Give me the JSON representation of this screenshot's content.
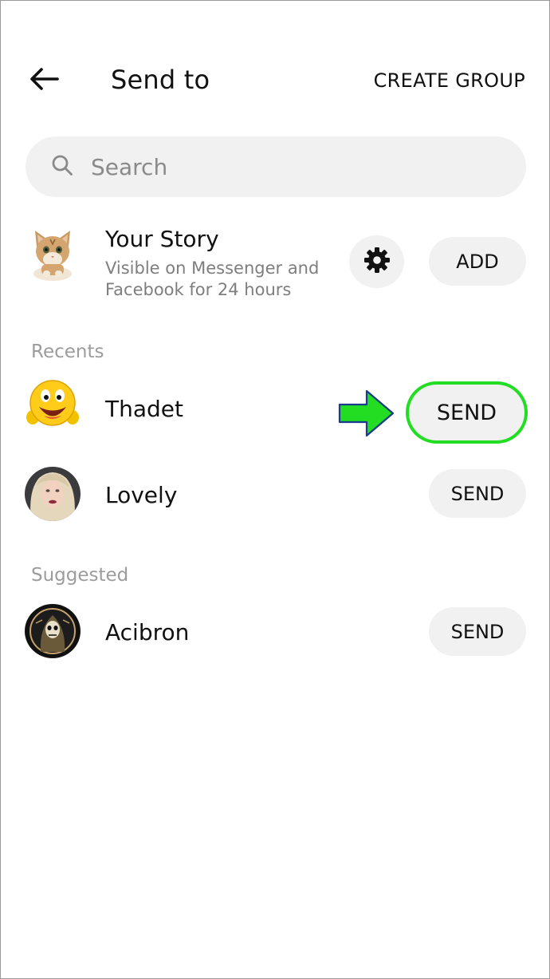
{
  "header": {
    "title": "Send to",
    "create_group": "CREATE GROUP"
  },
  "search": {
    "placeholder": "Search",
    "value": ""
  },
  "story": {
    "title": "Your Story",
    "subtitle_line1": "Visible on Messenger and",
    "subtitle_line2": "Facebook for 24 hours",
    "add_label": "ADD"
  },
  "recents": {
    "heading": "Recents",
    "items": [
      {
        "name": "Thadet",
        "send_label": "SEND",
        "highlight_color": "#22dd22"
      },
      {
        "name": "Lovely",
        "send_label": "SEND"
      }
    ]
  },
  "suggested": {
    "heading": "Suggested",
    "items": [
      {
        "name": "Acibron",
        "send_label": "SEND"
      }
    ]
  },
  "colors": {
    "pill_bg": "#f1f1f1",
    "annotation_arrow": "#22dd22",
    "annotation_outline": "#1a3c8c"
  }
}
